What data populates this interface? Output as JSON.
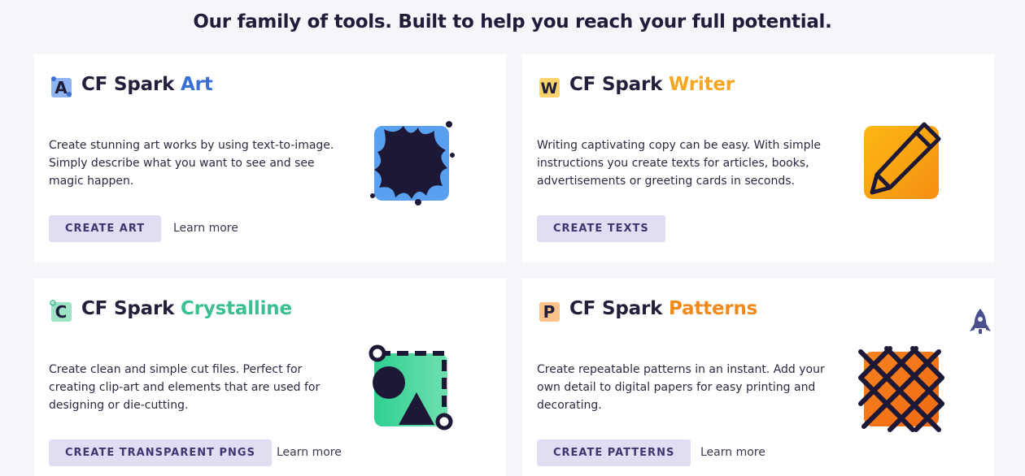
{
  "headline": "Our family of tools. Built to help you reach your full potential.",
  "colors": {
    "art": "#3a6fd6",
    "writer": "#f5a623",
    "crystalline": "#3bbf8f",
    "patterns": "#f08a1c",
    "button_bg": "#e2ddf2",
    "button_text": "#3f3670"
  },
  "cards": [
    {
      "logo_letter": "A",
      "title_prefix": "CF Spark ",
      "title_accent": "Art",
      "description": "Create stunning art works by using text-to-image. Simply describe what you want to see and see magic happen.",
      "button": "CREATE ART",
      "learn_more": "Learn more",
      "icon": "paint-splash-icon"
    },
    {
      "logo_letter": "W",
      "title_prefix": "CF Spark ",
      "title_accent": "Writer",
      "description": "Writing captivating copy can be easy. With simple instructions you create texts for articles, books, advertisements or greeting cards in seconds.",
      "button": "CREATE TEXTS",
      "icon": "pencil-icon"
    },
    {
      "logo_letter": "C",
      "title_prefix": "CF Spark ",
      "title_accent": "Crystalline",
      "description": "Create clean and simple cut files. Perfect for creating clip-art and elements that are used for designing or die-cutting.",
      "button": "CREATE TRANSPARENT PNGS",
      "learn_more": "Learn more",
      "icon": "cut-shapes-icon"
    },
    {
      "logo_letter": "P",
      "title_prefix": "CF Spark ",
      "title_accent": "Patterns",
      "description": "Create repeatable patterns in an instant. Add your own detail to digital papers for easy printing and decorating.",
      "button": "CREATE PATTERNS",
      "learn_more": "Learn more",
      "icon": "pattern-grid-icon"
    }
  ]
}
